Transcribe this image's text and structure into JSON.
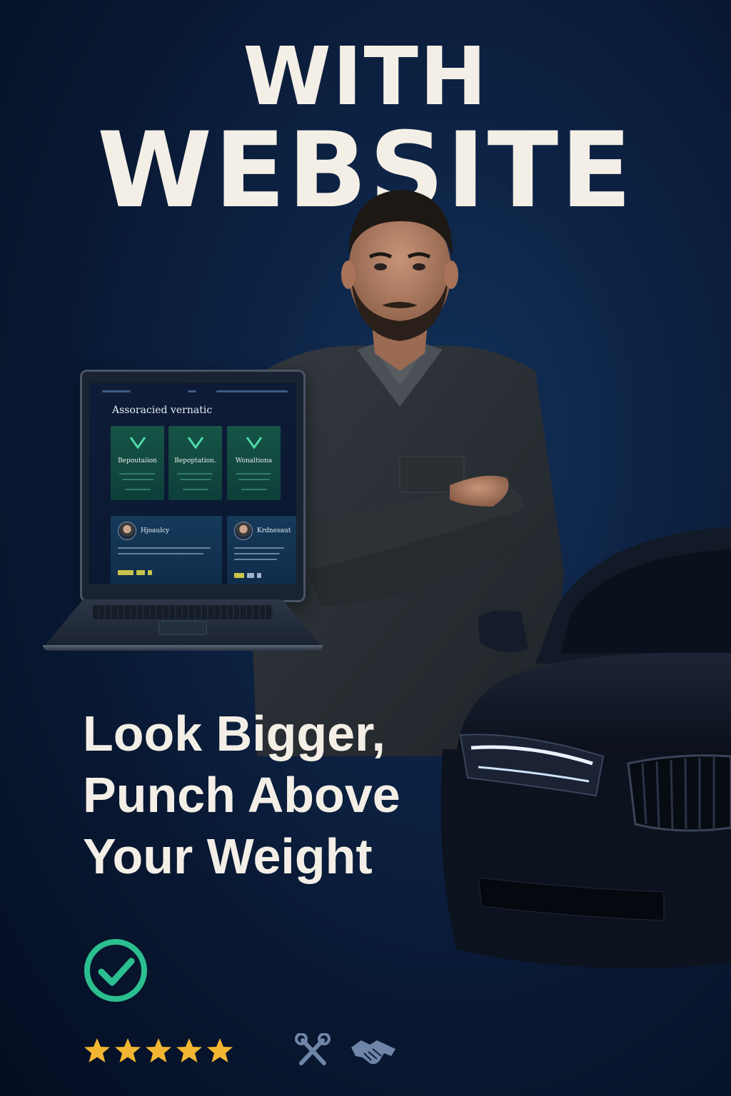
{
  "headline": {
    "line1": "WITH",
    "line2": "WEBSITE"
  },
  "laptop_screen": {
    "heading": "Assoracied vernatic",
    "cards": [
      {
        "title": "Bepoutaiion"
      },
      {
        "title": "Bepoptation."
      },
      {
        "title": "Wonaltiona"
      }
    ],
    "testimonials": [
      {
        "name": "Hjoaulcy"
      },
      {
        "name": "Krdnesaut"
      }
    ]
  },
  "tagline": {
    "lines": [
      "Look Bigger,",
      "Punch Above",
      "Your Weight"
    ]
  },
  "badges": {
    "check_icon": "check-circle-icon",
    "rating_stars": 5,
    "service_icons": [
      "tools-icon",
      "handshake-icon"
    ]
  },
  "colors": {
    "background": "#0b1d3a",
    "text": "#f4efe6",
    "check_accent": "#2bbf8f",
    "star": "#f2b632"
  }
}
